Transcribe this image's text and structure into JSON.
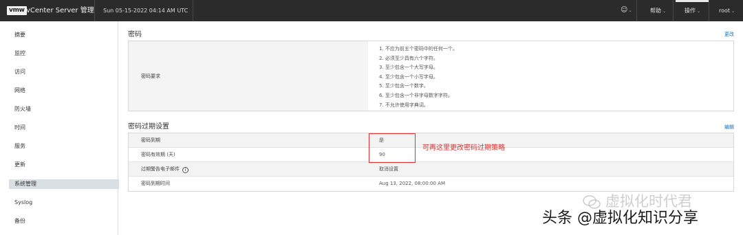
{
  "header": {
    "logo": "vmw",
    "app_title": "vCenter Server 管理",
    "datetime": "Sun 05-15-2022 04:14 AM UTC",
    "menus": [
      {
        "label": "帮助"
      },
      {
        "label": "操作"
      },
      {
        "label": "root"
      }
    ]
  },
  "sidebar": {
    "items": [
      {
        "label": "摘要"
      },
      {
        "label": "监控"
      },
      {
        "label": "访问"
      },
      {
        "label": "网络"
      },
      {
        "label": "防火墙"
      },
      {
        "label": "时间"
      },
      {
        "label": "服务"
      },
      {
        "label": "更新"
      },
      {
        "label": "系统管理"
      },
      {
        "label": "Syslog"
      },
      {
        "label": "备份"
      }
    ],
    "active_item": "系统管理"
  },
  "password": {
    "title": "密码",
    "action": "更改",
    "requirements_label": "密码要求",
    "requirements": [
      "1. 不应为前五个密码中的任何一个。",
      "2. 必须至少具有六个字符。",
      "3. 至少包含一个大写字母。",
      "4. 至少包含一个小写字母。",
      "5. 至少包含一个数字。",
      "6. 至少包含一个非字母数字字符。",
      "7. 不允许使用字典词。"
    ]
  },
  "expiration": {
    "title": "密码过期设置",
    "action": "编辑",
    "rows": [
      {
        "label": "密码到期",
        "value": "是"
      },
      {
        "label": "密码有效期 (天)",
        "value": "90"
      },
      {
        "label": "过期警告电子邮件",
        "value": "取消设置"
      },
      {
        "label": "密码到期时间",
        "value": "Aug 13, 2022, 08:00:00 AM"
      }
    ]
  },
  "annotation": "可再这里更改密码过期策略",
  "watermarks": {
    "wechat": "虚拟化时代君",
    "toutiao": "头条 @虚拟化知识分享"
  },
  "colors": {
    "header_bg": "#2b2b2b",
    "link": "#1a6db3",
    "annotation_red": "#e02b2b",
    "active_nav_bg": "#d8e0e6"
  }
}
